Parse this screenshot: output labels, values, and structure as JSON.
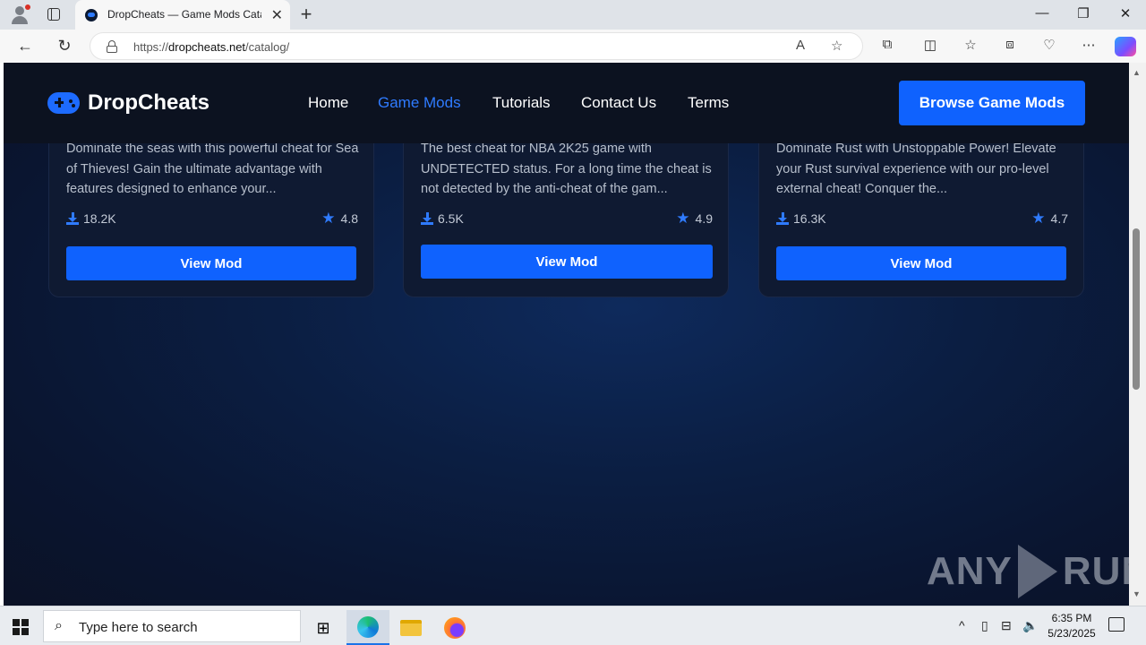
{
  "browser": {
    "tab_title": "DropCheats — Game Mods Catalog",
    "url_prefix": "https://",
    "url_domain": "dropcheats.net",
    "url_path": "/catalog/",
    "window_controls": [
      "—",
      "❐",
      "✕"
    ]
  },
  "site": {
    "brand": "DropCheats",
    "nav": [
      {
        "label": "Home",
        "active": false
      },
      {
        "label": "Game Mods",
        "active": true
      },
      {
        "label": "Tutorials",
        "active": false
      },
      {
        "label": "Contact Us",
        "active": false
      },
      {
        "label": "Terms",
        "active": false
      }
    ],
    "cta_label": "Browse Game Mods",
    "accent_color": "#0f62fe"
  },
  "cards": [
    {
      "description": "Dominate the seas with this powerful cheat for Sea of Thieves! Gain the ultimate advantage with features designed to enhance your...",
      "downloads": "18.2K",
      "rating": "4.8",
      "button": "View Mod"
    },
    {
      "description": "The best cheat for NBA 2K25 game with UNDETECTED status. For a long time the cheat is not detected by the anti-cheat of the gam...",
      "downloads": "6.5K",
      "rating": "4.9",
      "button": "View Mod"
    },
    {
      "description": "Dominate Rust with Unstoppable Power! Elevate your Rust survival experience with our pro-level external cheat! Conquer the...",
      "downloads": "16.3K",
      "rating": "4.7",
      "button": "View Mod"
    }
  ],
  "watermark": {
    "left": "ANY",
    "right": "RUN"
  },
  "taskbar": {
    "search_placeholder": "Type here to search",
    "time": "6:35 PM",
    "date": "5/23/2025"
  }
}
